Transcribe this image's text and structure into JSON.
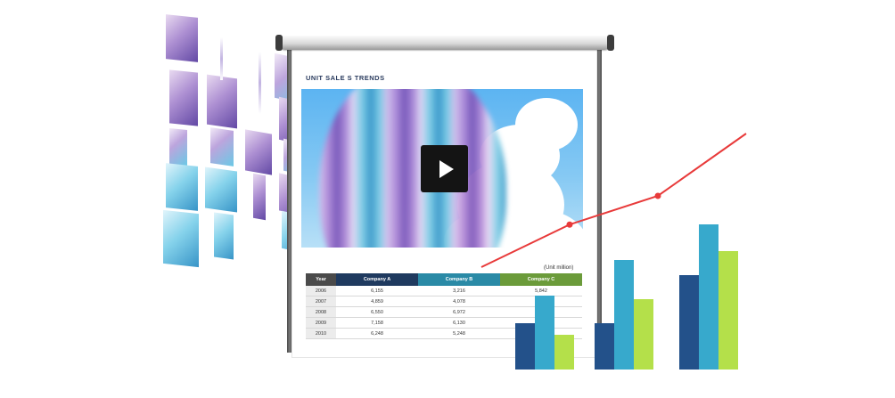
{
  "screen": {
    "title": "UNIT SALE S TRENDS"
  },
  "video": {
    "play_icon": "play-icon"
  },
  "table": {
    "unit_note": "(Unit million)",
    "headers": [
      "Year",
      "Company A",
      "Company B",
      "Company C"
    ],
    "rows": [
      [
        "2006",
        "6,155",
        "3,216",
        "5,842"
      ],
      [
        "2007",
        "4,859",
        "4,078",
        ""
      ],
      [
        "2008",
        "6,550",
        "6,972",
        ""
      ],
      [
        "2009",
        "7,158",
        "6,130",
        ""
      ],
      [
        "2010",
        "6,248",
        "5,248",
        ""
      ]
    ]
  },
  "colors": {
    "series_a": "#23518a",
    "series_b": "#37a9cc",
    "series_c": "#b4e04a",
    "trend": "#e83a3a"
  },
  "chart_data": {
    "type": "bar",
    "categories": [
      "",
      "",
      ""
    ],
    "series": [
      {
        "values": [
          52,
          52,
          106
        ]
      },
      {
        "values": [
          83,
          123,
          163
        ]
      },
      {
        "values": [
          39,
          79,
          133
        ]
      }
    ],
    "ylim": [
      0,
      175
    ],
    "trend_line": {
      "x": [
        0,
        1,
        2,
        3
      ],
      "y": [
        0,
        43,
        72,
        135
      ]
    }
  }
}
